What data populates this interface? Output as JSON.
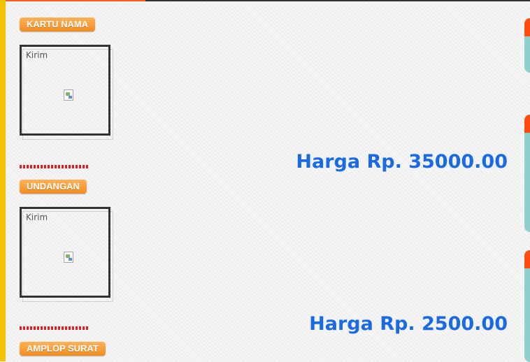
{
  "categories": [
    {
      "label": "KARTU NAMA",
      "image_alt": "Kirim",
      "price": "Harga Rp. 35000.00"
    },
    {
      "label": "UNDANGAN",
      "image_alt": "Kirim",
      "price": "Harga Rp. 2500.00"
    },
    {
      "label": "AMPLOP SURAT"
    }
  ],
  "colors": {
    "accent_orange": "#f48c1e",
    "price_blue": "#1a6ae6",
    "divider_red": "#e21c1c",
    "left_stripe": "#f5c400",
    "side_tab_teal": "#8fd0cc",
    "side_tab_cap": "#ff4a10"
  }
}
